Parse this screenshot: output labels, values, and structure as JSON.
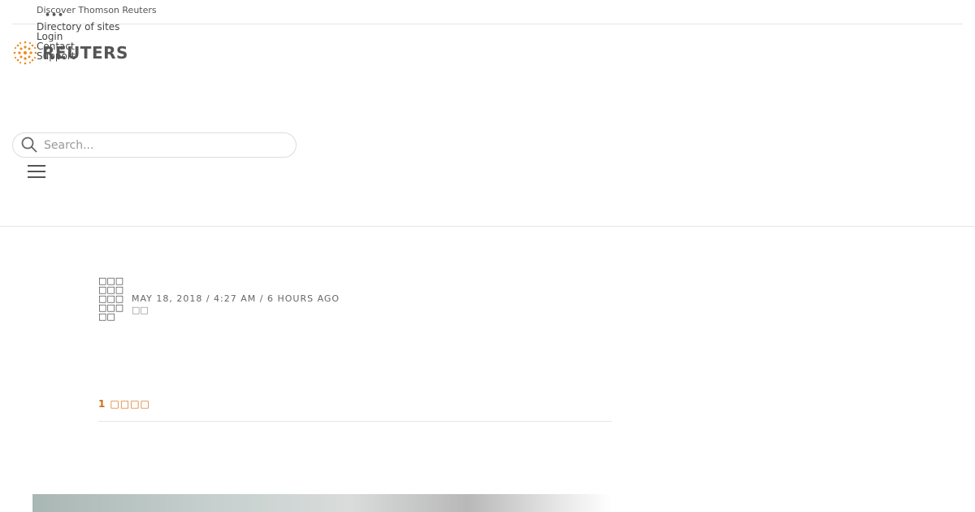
{
  "header": {
    "discover_label": "Discover Thomson Reuters",
    "more_glyph": "•••",
    "util_links": [
      "Directory of sites",
      "Login",
      "Contact",
      "Support"
    ],
    "logo_text": "REUTERS",
    "brand_color": "#ee8a1e"
  },
  "search": {
    "placeholder": "Search...",
    "value": ""
  },
  "icons": {
    "search": "search-icon",
    "menu": "hamburger-menu-icon"
  },
  "article": {
    "author": "□□□□□□□□□□□□□□",
    "date": "MAY 18, 2018 / 4:27 AM / 6 HOURS AGO",
    "read_time": "□□",
    "related_count_label": "1 □□□□"
  },
  "colors": {
    "accent": "#d36a12",
    "rule": "#e6e6e6"
  }
}
